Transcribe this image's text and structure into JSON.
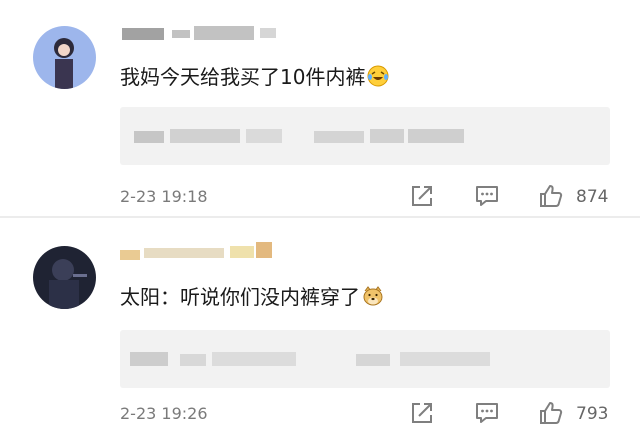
{
  "comments": [
    {
      "text": "我妈今天给我买了10件内裤",
      "emoji": "laughing-tears-emoji",
      "time": "2-23 19:18",
      "likes": "874"
    },
    {
      "text": "太阳：听说你们没内裤穿了",
      "emoji": "doge-emoji",
      "time": "2-23 19:26",
      "likes": "793"
    }
  ],
  "colors": {
    "timestamp": "#7a7a7a",
    "reply_box": "#f2f2f2",
    "icon": "#7f7f7f"
  }
}
